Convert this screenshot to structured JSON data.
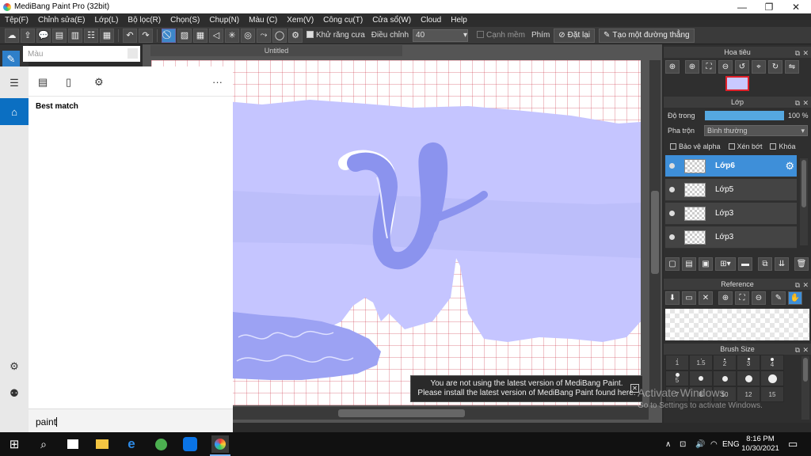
{
  "window": {
    "title": "MediBang Paint Pro (32bit)",
    "minimize": "—",
    "maximize": "❐",
    "close": "✕"
  },
  "menu": [
    "Tệp(F)",
    "Chỉnh sửa(E)",
    "Lớp(L)",
    "Bộ lọc(R)",
    "Chọn(S)",
    "Chụp(N)",
    "Màu (C)",
    "Xem(V)",
    "Công cụ(T)",
    "Cửa sổ(W)",
    "Cloud",
    "Help"
  ],
  "toolbar": {
    "antialias_label": "Khử răng cưa",
    "adjust_label": "Điều chỉnh",
    "adjust_value": "40",
    "edge_label": "Cạnh mềm",
    "key_label": "Phím",
    "reset_label": "Đặt lại",
    "straight_label": "Tạo một đường thẳng"
  },
  "color_panel": {
    "label": "Màu"
  },
  "document": {
    "tab": "Untitled"
  },
  "notice": {
    "line1": "You are not using the latest version of MediBang Paint.",
    "line2": "Please install the latest version of MediBang Paint found here."
  },
  "navigator": {
    "title": "Hoa tiêu"
  },
  "layers": {
    "title": "Lớp",
    "opacity_label": "Độ trong",
    "opacity_value": "100 %",
    "opacity": 1.0,
    "blend_label": "Pha trộn",
    "blend_value": "Bình thường",
    "protect_alpha": "Bảo vệ alpha",
    "clipping": "Xén bớt",
    "lock": "Khóa",
    "items": [
      {
        "name": "Lớp6",
        "selected": true
      },
      {
        "name": "Lớp5",
        "selected": false
      },
      {
        "name": "Lớp3",
        "selected": false
      },
      {
        "name": "Lớp3",
        "selected": false
      }
    ]
  },
  "reference": {
    "title": "Reference"
  },
  "brush_size": {
    "title": "Brush Size",
    "values": [
      "1",
      "1.5",
      "2",
      "3",
      "4",
      "5",
      "",
      "",
      "",
      "",
      "7",
      "8",
      "10",
      "12",
      "15"
    ]
  },
  "watermark": {
    "line1": "Activate Windows",
    "line2": "Go to Settings to activate Windows."
  },
  "start_menu": {
    "best_match": "Best match",
    "search_value": "paint",
    "more": "···"
  },
  "tray": {
    "lang": "ENG",
    "time": "8:16 PM",
    "date": "10/30/2021"
  },
  "colors": {
    "accent": "#3e8fd9",
    "canvas_shape": "#c5c5ff",
    "letter": "#8b93ee"
  }
}
